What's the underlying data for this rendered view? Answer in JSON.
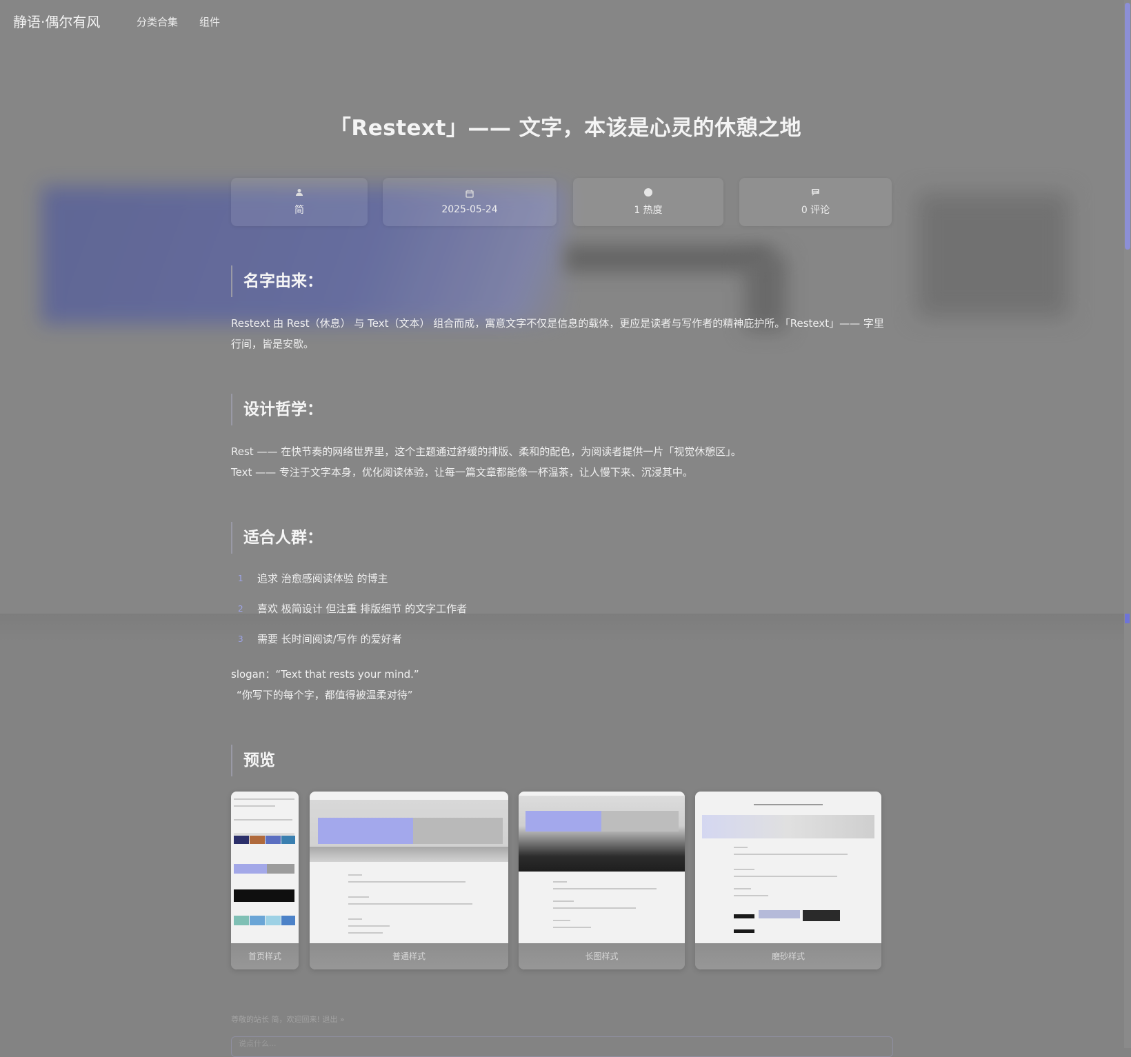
{
  "nav": {
    "logo": "静语·偶尔有风",
    "links": [
      "分类合集",
      "组件"
    ]
  },
  "post": {
    "title": "「Restext」—— 文字，本该是心灵的休憩之地",
    "meta": {
      "author": "简",
      "date": "2025-05-24",
      "views": "1 热度",
      "comments": "0 评论"
    },
    "sections": [
      {
        "heading": "名字由来：",
        "lines": [
          "Restext 由 Rest（休息） 与 Text（文本） 组合而成，寓意文字不仅是信息的载体，更应是读者与写作者的精神庇护所。「Restext」—— 字里",
          "行间，皆是安歇。"
        ]
      },
      {
        "heading": "设计哲学：",
        "lines": [
          "Rest —— 在快节奏的网络世界里，这个主题通过舒缓的排版、柔和的配色，为阅读者提供一片「视觉休憩区」。",
          "Text —— 专注于文字本身，优化阅读体验，让每一篇文章都能像一杯温茶，让人慢下来、沉浸其中。"
        ]
      },
      {
        "heading": "适合人群：",
        "list": [
          {
            "num": "1",
            "text": "追求 治愈感阅读体验 的博主"
          },
          {
            "num": "2",
            "text": "喜欢 极简设计 但注重 排版细节 的文字工作者"
          },
          {
            "num": "3",
            "text": "需要 长时间阅读/写作 的爱好者"
          }
        ]
      }
    ],
    "slogan": {
      "en": "slogan：“Text that rests your mind.”",
      "zh": "“你写下的每个字，都值得被温柔对待”"
    },
    "preview": {
      "heading": "预览",
      "cards": [
        "首页样式",
        "普通样式",
        "长图样式",
        "磨砂样式"
      ]
    }
  },
  "footer": {
    "greeting": "尊敬的站长 简，欢迎回来! 退出 »",
    "input_placeholder": "说点什么..."
  },
  "colors": {
    "accent": "#8c8fd6",
    "background": "#838383"
  }
}
